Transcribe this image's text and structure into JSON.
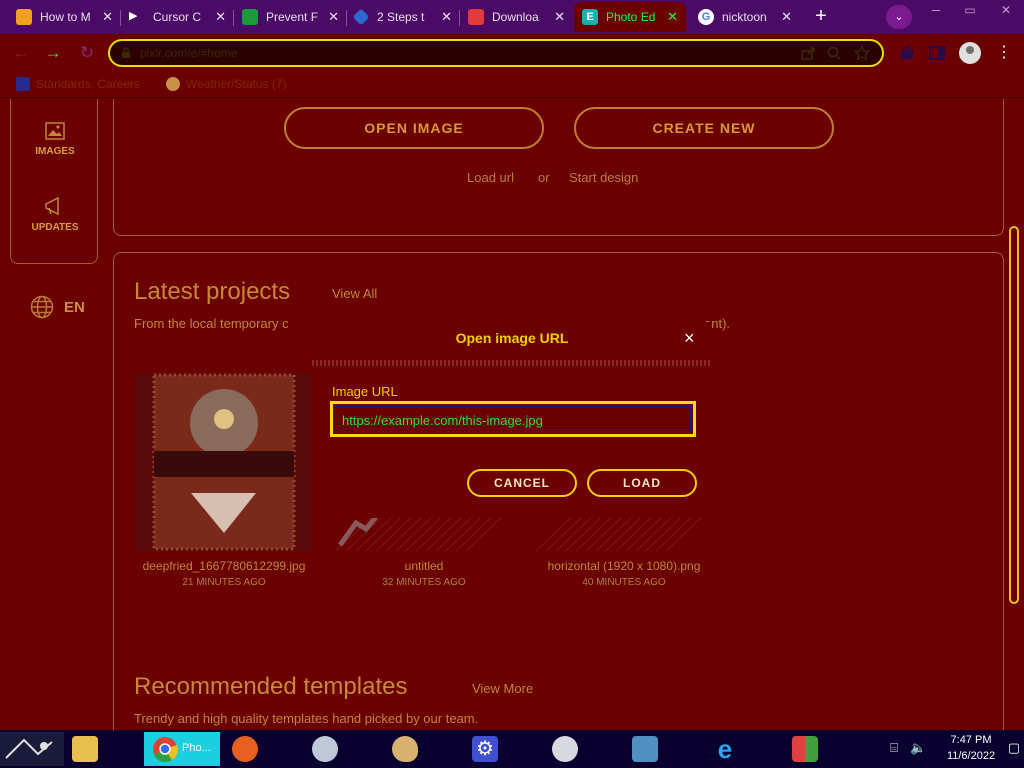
{
  "browser": {
    "tabs": [
      {
        "title": "How to M",
        "active": false
      },
      {
        "title": "Cursor C",
        "active": false
      },
      {
        "title": "Prevent F",
        "active": false
      },
      {
        "title": "2 Steps t",
        "active": false
      },
      {
        "title": "Downloa",
        "active": false
      },
      {
        "title": "Photo Ed",
        "active": true
      },
      {
        "title": "nicktoon",
        "active": false
      }
    ],
    "new_tab": "+",
    "tab_menu": "⌄",
    "url": "pixlr.com/e/#home",
    "bookmarks": [
      {
        "label": "Standards, Careers"
      },
      {
        "label": "Weather/Status (7)"
      }
    ]
  },
  "sidebar": {
    "items": [
      {
        "label": "IMAGES",
        "icon": "image-icon"
      },
      {
        "label": "UPDATES",
        "icon": "megaphone-icon"
      }
    ],
    "language": "EN"
  },
  "top_card": {
    "open_image": "OPEN IMAGE",
    "create_new": "CREATE NEW",
    "load_url": "Load url",
    "or": "or",
    "start_design": "Start design"
  },
  "projects": {
    "title": "Latest projects",
    "view_all": "View All",
    "subtitle_left": "From the local temporary c",
    "subtitle_right": "ent).",
    "items": [
      {
        "name": "deepfried_1667780612299.jpg",
        "time": "21 MINUTES AGO"
      },
      {
        "name": "untitled",
        "time": "32 MINUTES AGO"
      },
      {
        "name": "horizontal (1920 x 1080).png",
        "time": "40 MINUTES AGO"
      }
    ]
  },
  "templates": {
    "title": "Recommended templates",
    "view_more": "View More",
    "subtitle": "Trendy and high quality templates hand picked by our team."
  },
  "modal": {
    "title": "Open image URL",
    "close": "×",
    "label": "Image URL",
    "placeholder": "https://example.com/this-image.jpg",
    "cancel": "CANCEL",
    "load": "LOAD"
  },
  "taskbar": {
    "chrome_label": "Pho...",
    "time": "7:47 PM",
    "date": "11/6/2022"
  },
  "colors": {
    "page_bg": "#6b0000",
    "accent_yellow": "#f0d000",
    "active_tab_text": "#20ff40",
    "tabbar_bg": "#4a0a66"
  }
}
